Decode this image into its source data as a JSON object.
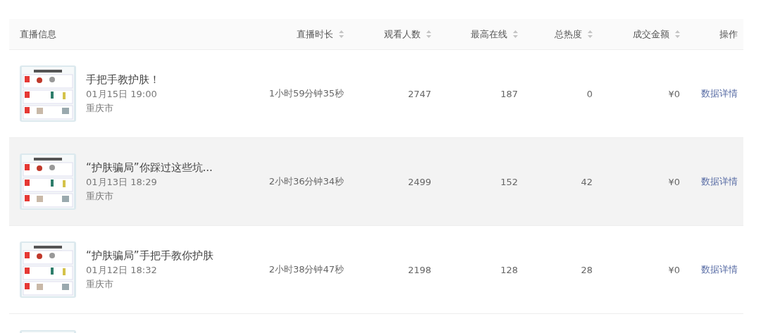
{
  "table": {
    "columns": [
      {
        "label": "直播信息",
        "sortable": false
      },
      {
        "label": "直播时长",
        "sortable": true
      },
      {
        "label": "观看人数",
        "sortable": true
      },
      {
        "label": "最高在线",
        "sortable": true
      },
      {
        "label": "总热度",
        "sortable": true
      },
      {
        "label": "成交金额",
        "sortable": true
      },
      {
        "label": "操作",
        "sortable": false
      }
    ],
    "rows": [
      {
        "highlighted": false,
        "title": "手把手教护肤！",
        "time": "01月15日 19:00",
        "city": "重庆市",
        "duration": "1小时59分钟35秒",
        "viewers": "2747",
        "peak_online": "187",
        "heat": "0",
        "amount": "¥0",
        "action": "数据详情"
      },
      {
        "highlighted": true,
        "title": "“护肤骗局”你踩过这些坑...",
        "time": "01月13日 18:29",
        "city": "重庆市",
        "duration": "2小时36分钟34秒",
        "viewers": "2499",
        "peak_online": "152",
        "heat": "42",
        "amount": "¥0",
        "action": "数据详情"
      },
      {
        "highlighted": false,
        "title": "“护肤骗局”手把手教你护肤",
        "time": "01月12日 18:32",
        "city": "重庆市",
        "duration": "2小时38分钟47秒",
        "viewers": "2198",
        "peak_online": "128",
        "heat": "28",
        "amount": "¥0",
        "action": "数据详情"
      },
      {
        "highlighted": false
      }
    ]
  }
}
